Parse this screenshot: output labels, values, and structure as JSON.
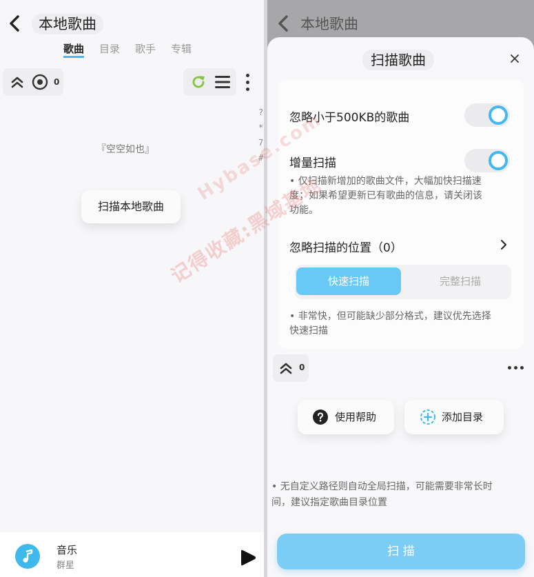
{
  "left": {
    "title": "本地歌曲",
    "tabs": [
      {
        "label": "歌曲",
        "active": true
      },
      {
        "label": "目录",
        "active": false
      },
      {
        "label": "歌手",
        "active": false
      },
      {
        "label": "专辑",
        "active": false
      }
    ],
    "toolbar": {
      "count": "0"
    },
    "index_letters": [
      "?",
      "*",
      "7",
      "#"
    ],
    "empty_text": "『空空如也』",
    "scan_local_label": "扫描本地歌曲",
    "player": {
      "title": "音乐",
      "artist": "群星"
    }
  },
  "right": {
    "header_title": "本地歌曲",
    "sheet_title": "扫描歌曲",
    "ignore_small": {
      "label": "忽略小于500KB的歌曲",
      "enabled": true
    },
    "incremental": {
      "label": "增量扫描",
      "enabled": true
    },
    "incremental_note_1": "• 仅扫描新增加的歌曲文件，大幅加快扫描速",
    "incremental_note_2": "度；如果希望更新已有歌曲的信息，请关闭该",
    "incremental_note_3": "功能。",
    "ignore_locations_label": "忽略扫描的位置（0）",
    "scan_mode": {
      "fast": "快速扫描",
      "full": "完整扫描",
      "selected": "fast"
    },
    "mode_note_1": "• 非常快，但可能缺少部分格式，建议优先选择",
    "mode_note_2": "快速扫描",
    "count": "0",
    "help_label": "使用帮助",
    "add_dir_label": "添加目录",
    "bottom_note_1": "• 无自定义路径则自动全局扫描，可能需要非常长时",
    "bottom_note_2": "间，建议指定歌曲目录位置",
    "scan_label": "扫 描"
  },
  "watermark": {
    "line1": "记得收藏:黑域基地",
    "line2": "Hybase.com"
  },
  "colors": {
    "accent": "#43b8ee",
    "button_fill": "#7ccdf5",
    "refresh_green": "#8bc34a"
  }
}
